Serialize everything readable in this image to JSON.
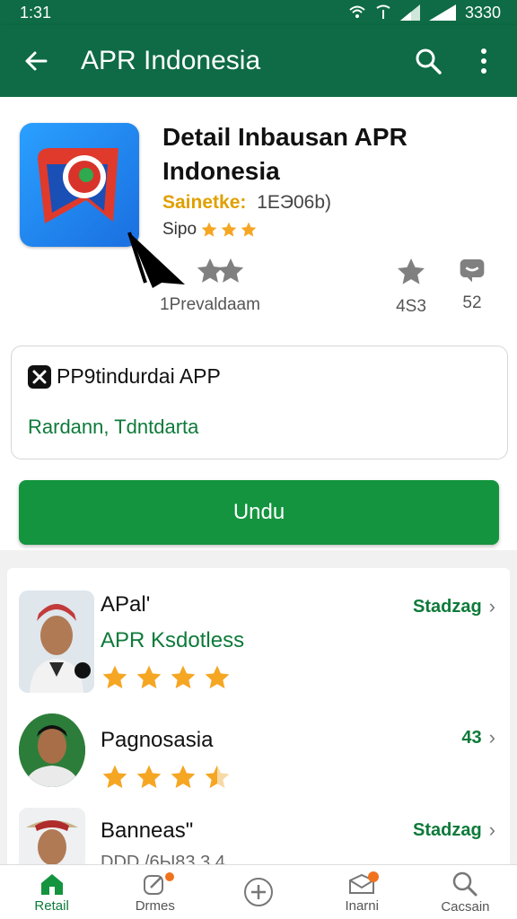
{
  "status_bar": {
    "time": "1:31",
    "right_text": "3330"
  },
  "app_bar": {
    "title": "APR Indonesia",
    "back_icon": "arrow-back-icon",
    "search_icon": "search-icon",
    "menu_icon": "more-vert-icon"
  },
  "app": {
    "name": "Detail Inbausan APR Indonesia",
    "meta_label": "Sainetke:",
    "meta_value": "1ЕЭ06b)",
    "sub_label": "Sipo",
    "sub_stars": 3,
    "stats": [
      {
        "icon": "star-icon",
        "label": "1Prevaldaam"
      },
      {
        "icon": "star-icon",
        "label": ""
      },
      {
        "icon": "star-icon",
        "label": "4S3"
      },
      {
        "icon": "chat-icon",
        "label": "52"
      }
    ]
  },
  "info": {
    "title": "PP9tindurdai APP",
    "subtitle": "Rardann, Tdntdarta"
  },
  "install_button": {
    "label": "Undu"
  },
  "reviews": [
    {
      "title": "APal'",
      "subtitle": "APR Ksdotless",
      "rating": 4,
      "right_label": "Stadzag"
    },
    {
      "title": "Pagnosasia",
      "subtitle": "",
      "rating": 3.5,
      "right_label": "43"
    },
    {
      "title": "Banneas\"",
      "subtitle": "",
      "faded": "DDD /6Ы83 3 4",
      "right_label": "Stadzag"
    }
  ],
  "bottom_nav": [
    {
      "icon": "home-icon",
      "label": "Retail",
      "active": true
    },
    {
      "icon": "edit-icon",
      "label": "Drmes",
      "active": false
    },
    {
      "icon": "add-circle-icon",
      "label": "",
      "active": false
    },
    {
      "icon": "mail-icon",
      "label": "Inarni",
      "active": false
    },
    {
      "icon": "search-icon",
      "label": "Cacsain",
      "active": false
    }
  ],
  "colors": {
    "primary": "#0e6b45",
    "accent": "#14943f",
    "star": "#f5a623",
    "link": "#0e7a3a"
  }
}
